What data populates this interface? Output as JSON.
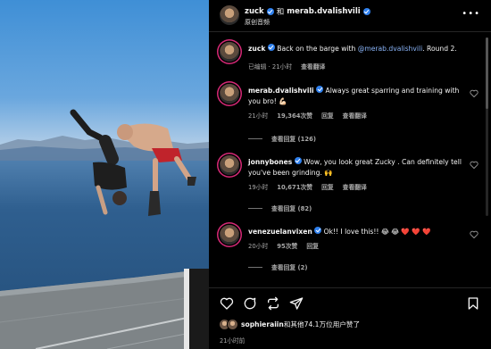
{
  "header": {
    "user1": "zuck",
    "connector": "和",
    "user2": "merab.dvalishvili",
    "audio": "原创音频",
    "more_icon": "more-horizontal-icon"
  },
  "caption": {
    "user": "zuck",
    "text_before": "Back on the barge with ",
    "mention": "@merab.dvalishvili",
    "text_after": ". Round 2.",
    "edited": "已编辑",
    "time": "21小时",
    "translate": "查看翻译"
  },
  "comments": [
    {
      "user": "merab.dvalishvili",
      "text": "Always great sparring and training with you bro! 💪🏻",
      "time": "21小时",
      "likes": "19,364次赞",
      "reply": "回复",
      "translate": "查看翻译",
      "view_replies": "查看回复 (126)"
    },
    {
      "user": "jonnybones",
      "text": "Wow, you look great Zucky . Can definitely tell you've been grinding. 🙌",
      "time": "19小时",
      "likes": "10,671次赞",
      "reply": "回复",
      "translate": "查看翻译",
      "view_replies": "查看回复 (82)"
    },
    {
      "user": "venezuelanvixen",
      "text": "Ok!! I love this!! 😂 😂 ❤️ ❤️ ❤️",
      "time": "20小时",
      "likes": "95次赞",
      "reply": "回复",
      "view_replies": "查看回复 (2)"
    }
  ],
  "actions": {
    "like_icon": "heart-icon",
    "comment_icon": "comment-icon",
    "share_icon": "repost-icon",
    "send_icon": "send-icon",
    "save_icon": "bookmark-icon"
  },
  "likes_summary": {
    "user": "sophieraiin",
    "text": "和其他74.1万位用户赞了"
  },
  "post_time": "21小时前",
  "colors": {
    "background": "#000000",
    "mention": "#8ab4f8",
    "verified": "#2f80ed",
    "secondary_text": "#a8a8a8"
  }
}
